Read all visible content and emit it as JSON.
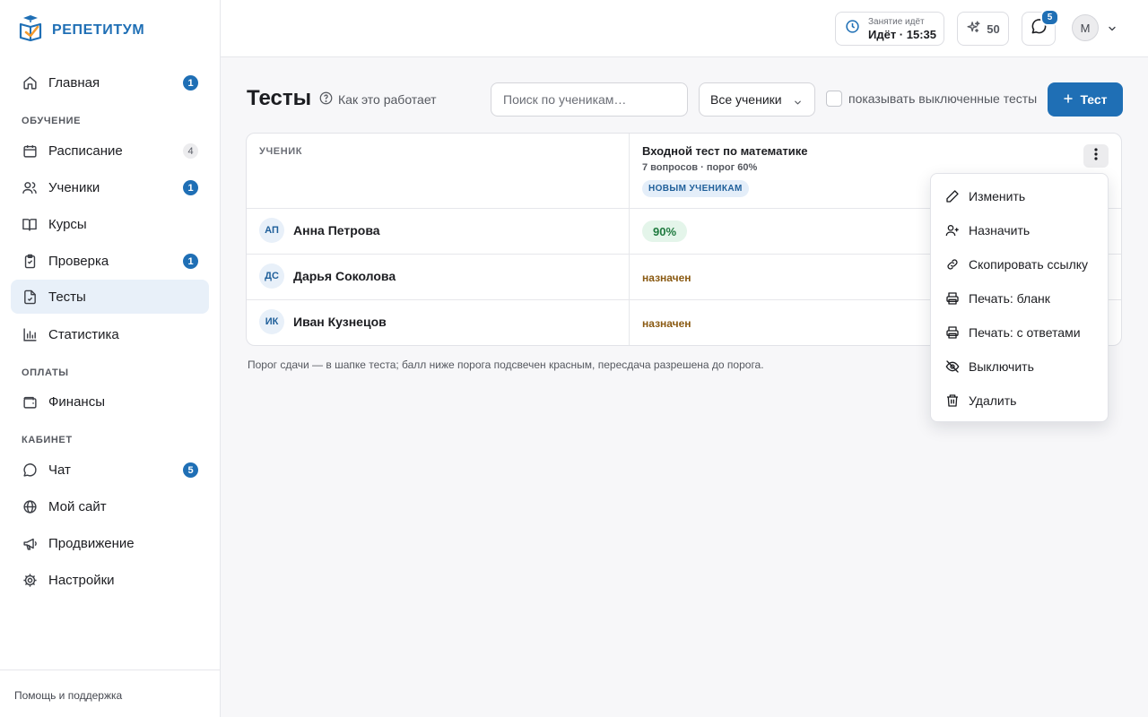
{
  "brand": {
    "name": "РЕПЕТИТУМ"
  },
  "sidebar": {
    "items": [
      {
        "label": "Главная",
        "icon": "home-icon",
        "badge": "1"
      },
      {
        "label": "Расписание",
        "icon": "calendar-icon",
        "badge": "4"
      },
      {
        "label": "Ученики",
        "icon": "users-icon",
        "badge": "1"
      },
      {
        "label": "Курсы",
        "icon": "book-icon",
        "badge": ""
      },
      {
        "label": "Проверка",
        "icon": "clipboard-icon",
        "badge": "1"
      },
      {
        "label": "Тесты",
        "icon": "test-file-icon",
        "badge": "",
        "active": true
      },
      {
        "label": "Статистика",
        "icon": "bar-chart-icon",
        "badge": ""
      },
      {
        "label": "Финансы",
        "icon": "wallet-icon",
        "badge": ""
      },
      {
        "label": "Чат",
        "icon": "chat-icon",
        "badge": "5"
      },
      {
        "label": "Мой сайт",
        "icon": "globe-icon",
        "badge": ""
      },
      {
        "label": "Продвижение",
        "icon": "megaphone-icon",
        "badge": ""
      },
      {
        "label": "Настройки",
        "icon": "gear-icon",
        "badge": ""
      }
    ],
    "sections": {
      "learning": "ОБУЧЕНИЕ",
      "payments": "ОПЛАТЫ",
      "cabinet": "КАБИНЕТ"
    },
    "help": "Помощь и поддержка"
  },
  "topbar": {
    "lesson_caption": "Занятие идёт",
    "lesson_status": "Идёт · 15:35",
    "points": "50",
    "chat_badge": "5",
    "avatar_initial": "М"
  },
  "page": {
    "title": "Тесты",
    "howto": "Как это работает",
    "search_placeholder": "Поиск по ученикам…",
    "filter_value": "Все ученики",
    "show_disabled_label": "показывать выключенные тесты",
    "show_disabled_checked": false,
    "add_button": "Тест"
  },
  "table": {
    "student_header": "УЧЕНИК",
    "test": {
      "title": "Входной тест по математике",
      "meta": "7 вопросов · порог 60%",
      "tag": "НОВЫМ УЧЕНИКАМ"
    },
    "rows": [
      {
        "initials": "АП",
        "name": "Анна Петрова",
        "result": "90%",
        "kind": "score"
      },
      {
        "initials": "ДС",
        "name": "Дарья Соколова",
        "result": "назначен",
        "kind": "assigned"
      },
      {
        "initials": "ИК",
        "name": "Иван Кузнецов",
        "result": "назначен",
        "kind": "assigned"
      }
    ]
  },
  "footnote": "Порог сдачи — в шапке теста; балл ниже порога подсвечен красным, пересдача разрешена до порога.",
  "menu": {
    "items": [
      {
        "label": "Изменить",
        "icon": "pencil-icon"
      },
      {
        "label": "Назначить",
        "icon": "user-plus-icon"
      },
      {
        "label": "Скопировать ссылку",
        "icon": "link-icon"
      },
      {
        "label": "Печать: бланк",
        "icon": "printer-icon"
      },
      {
        "label": "Печать: с ответами",
        "icon": "printer-icon"
      },
      {
        "label": "Выключить",
        "icon": "eye-off-icon"
      },
      {
        "label": "Удалить",
        "icon": "trash-icon"
      }
    ]
  },
  "colors": {
    "accent": "#1f6fb5",
    "active_bg": "#e8f0f9",
    "score_bg": "#e4f5ea",
    "score_text": "#1f7a3f",
    "assigned_text": "#8a5a12"
  }
}
